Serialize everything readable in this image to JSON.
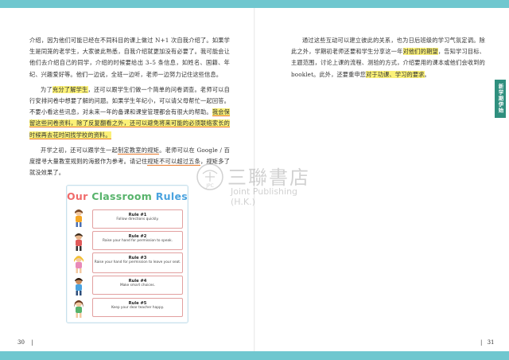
{
  "left_page": {
    "paragraphs": [
      {
        "segments": [
          {
            "text": "介绍，因为他们可能已经在不同科目的课上做过 N+1 次自我介绍了。如果学生是同笼的老学生，大家彼此熟悉，自我介绍就更加没有必要了。我可能会让他们去介绍自己的同学，介绍的时候要给出 3–5 条信息，如姓名、国籍、年纪、兴趣爱好等。他们一边说，全班一边听，老师一边努力记住这些信息。",
            "style": "plain"
          }
        ]
      },
      {
        "segments": [
          {
            "text": "为了",
            "style": "plain"
          },
          {
            "text": "充分了解学生",
            "style": "hl"
          },
          {
            "text": "，还可以跟学生们做一个简单的问卷调查。老师可以自行安排问卷中想要了解的问题。如果学生年纪小，可以请父母帮忙一起回答。不要小看这些讯息，对未来一年的备课和课堂管理都会有很大的帮助。",
            "style": "plain"
          },
          {
            "text": "我会保留这些问卷资料，除了反复翻看之外，还可以避免将来可能的必须联络家长的时候再去花时间找学校的资料。",
            "style": "hlo"
          }
        ]
      },
      {
        "segments": [
          {
            "text": "开学之初，还可以跟学生一起",
            "style": "plain"
          },
          {
            "text": "制定教室的规矩",
            "style": "ul"
          },
          {
            "text": "。老师可以在 Google / 百度搜寻大量教室规则的海报作为参考。请记住",
            "style": "plain"
          },
          {
            "text": "规矩不可以超过五条",
            "style": "ul"
          },
          {
            "text": "，规矩多了就没效果了。",
            "style": "plain"
          }
        ]
      }
    ],
    "page_number": "30"
  },
  "right_page": {
    "paragraphs": [
      {
        "segments": [
          {
            "text": "通过这些互动可以建立彼此的关系，也为日后班级的学习气氛定调。除此之外，学期初老师还要和学生分享这一年",
            "style": "plain"
          },
          {
            "text": "对他们的期望",
            "style": "hl"
          },
          {
            "text": "，告知学习目标、主题范围，讨论上课的流程、测验的方式，介绍要用的课本或他们会收到的 booklet。此外，还要重申您",
            "style": "plain"
          },
          {
            "text": "对于功课、学习的要求",
            "style": "hl"
          },
          {
            "text": "。",
            "style": "plain"
          }
        ]
      }
    ],
    "side_tab": "新学期伊始",
    "page_number": "31"
  },
  "poster": {
    "title_words": [
      "Our",
      "Classroom",
      "Rules"
    ],
    "rules": [
      {
        "title": "Rule #1",
        "desc": "Follow directions quickly."
      },
      {
        "title": "Rule #2",
        "desc": "Raise your hand for permission to speak."
      },
      {
        "title": "Rule #3",
        "desc": "Raise your hand for permission to leave your seat."
      },
      {
        "title": "Rule #4",
        "desc": "Make smart choices."
      },
      {
        "title": "Rule #5",
        "desc": "Keep your dear teacher happy."
      }
    ]
  },
  "watermark": {
    "zh": "三聯書店",
    "en": "Joint Publishing (H.K.)",
    "seal": "JPC"
  },
  "colors": {
    "band": "#6fc7cf",
    "highlight": "#fbf178",
    "underline": "#e97a2a",
    "side_tab": "#2f8f7e"
  }
}
